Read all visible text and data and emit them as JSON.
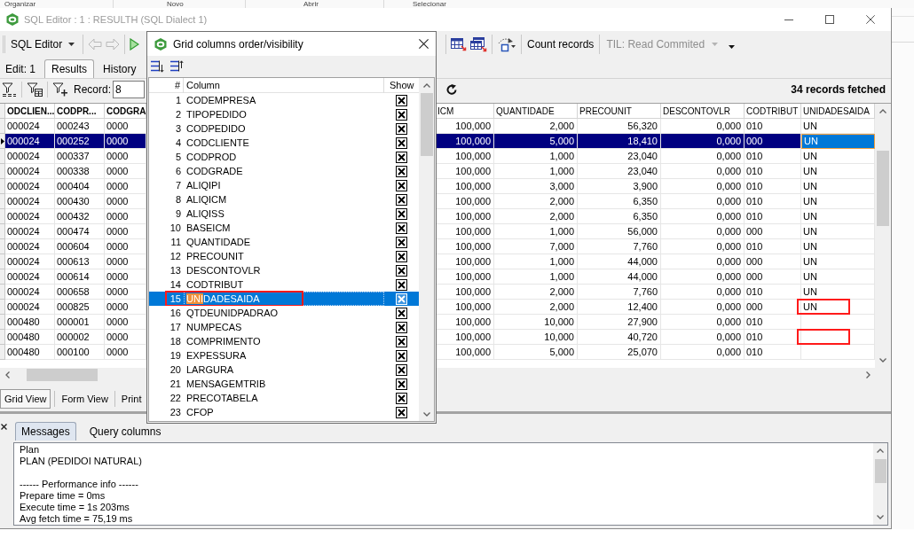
{
  "explorer_ribbon": {
    "buttons": [
      "Organizar",
      "Novo",
      "Abrir",
      "Selecionar"
    ]
  },
  "window": {
    "title": "SQL Editor : 1 : RESULTH (SQL Dialect 1)"
  },
  "toolbar": {
    "editor_menu": "SQL Editor",
    "history_buttons": {
      "disabled": true
    },
    "count_button": "Count records",
    "isolation_level": {
      "label": "TIL: Read Commited",
      "disabled": true
    }
  },
  "tabs": [
    {
      "label": "Edit: 1",
      "selected": false
    },
    {
      "label": "Results",
      "selected": true
    },
    {
      "label": "History",
      "selected": false
    }
  ],
  "record_bar": {
    "label": "Record:",
    "value": "8",
    "status": "34 records fetched"
  },
  "grid": {
    "columns": [
      {
        "label": "ODCLIEN...",
        "key": true,
        "kind": "text"
      },
      {
        "label": "CODPR...",
        "key": true,
        "kind": "text"
      },
      {
        "label": "CODGRA",
        "key": true,
        "kind": "text"
      },
      {
        "label": "ICM",
        "key": false,
        "kind": "number"
      },
      {
        "label": "QUANTIDADE",
        "key": false,
        "kind": "number"
      },
      {
        "label": "PRECOUNIT",
        "key": false,
        "kind": "number"
      },
      {
        "label": "DESCONTOVLR",
        "key": false,
        "kind": "number"
      },
      {
        "label": "CODTRIBUT",
        "key": false,
        "kind": "text"
      },
      {
        "label": "UNIDADESAIDA",
        "key": false,
        "kind": "text"
      }
    ],
    "rows": [
      {
        "cells": [
          "000024",
          "000243",
          "0000",
          "100,000",
          "2,000",
          "56,320",
          "0,000",
          "010",
          "UN"
        ],
        "selected": false,
        "current": false,
        "marked": false
      },
      {
        "cells": [
          "000024",
          "000252",
          "0000",
          "100,000",
          "5,000",
          "18,410",
          "0,000",
          "000",
          "UN"
        ],
        "selected": true,
        "current": true,
        "marked": false
      },
      {
        "cells": [
          "000024",
          "000337",
          "0000",
          "100,000",
          "1,000",
          "23,040",
          "0,000",
          "010",
          "UN"
        ],
        "selected": false,
        "current": false,
        "marked": false
      },
      {
        "cells": [
          "000024",
          "000338",
          "0000",
          "100,000",
          "1,000",
          "23,040",
          "0,000",
          "010",
          "UN"
        ],
        "selected": false,
        "current": false,
        "marked": false
      },
      {
        "cells": [
          "000024",
          "000404",
          "0000",
          "100,000",
          "3,000",
          "3,900",
          "0,000",
          "010",
          "UN"
        ],
        "selected": false,
        "current": false,
        "marked": false
      },
      {
        "cells": [
          "000024",
          "000430",
          "0000",
          "100,000",
          "2,000",
          "6,350",
          "0,000",
          "010",
          "UN"
        ],
        "selected": false,
        "current": false,
        "marked": false
      },
      {
        "cells": [
          "000024",
          "000432",
          "0000",
          "100,000",
          "2,000",
          "6,350",
          "0,000",
          "010",
          "UN"
        ],
        "selected": false,
        "current": false,
        "marked": false
      },
      {
        "cells": [
          "000024",
          "000474",
          "0000",
          "100,000",
          "1,000",
          "56,000",
          "0,000",
          "000",
          "UN"
        ],
        "selected": false,
        "current": false,
        "marked": false
      },
      {
        "cells": [
          "000024",
          "000604",
          "0000",
          "100,000",
          "7,000",
          "7,760",
          "0,000",
          "010",
          "UN"
        ],
        "selected": false,
        "current": false,
        "marked": false
      },
      {
        "cells": [
          "000024",
          "000613",
          "0000",
          "100,000",
          "1,000",
          "44,000",
          "0,000",
          "000",
          "UN"
        ],
        "selected": false,
        "current": false,
        "marked": false
      },
      {
        "cells": [
          "000024",
          "000614",
          "0000",
          "100,000",
          "1,000",
          "44,000",
          "0,000",
          "000",
          "UN"
        ],
        "selected": false,
        "current": false,
        "marked": false
      },
      {
        "cells": [
          "000024",
          "000658",
          "0000",
          "100,000",
          "2,000",
          "7,760",
          "0,000",
          "010",
          "UN"
        ],
        "selected": false,
        "current": false,
        "marked": false
      },
      {
        "cells": [
          "000024",
          "000825",
          "0000",
          "100,000",
          "2,000",
          "12,400",
          "0,000",
          "000",
          "UN"
        ],
        "selected": false,
        "current": false,
        "marked": true
      },
      {
        "cells": [
          "000480",
          "000001",
          "0000",
          "100,000",
          "10,000",
          "27,900",
          "0,000",
          "010"
        ],
        "selected": false,
        "current": false,
        "marked": false
      },
      {
        "cells": [
          "000480",
          "000002",
          "0000",
          "100,000",
          "10,000",
          "40,720",
          "0,000",
          "010"
        ],
        "selected": false,
        "current": false,
        "marked": true
      },
      {
        "cells": [
          "000480",
          "000100",
          "0000",
          "100,000",
          "5,000",
          "25,070",
          "0,000",
          "010"
        ],
        "selected": false,
        "current": false,
        "marked": false
      }
    ]
  },
  "view_tabs": [
    {
      "label": "Grid View",
      "selected": true
    },
    {
      "label": "Form View",
      "selected": false
    },
    {
      "label": "Print",
      "selected": false
    }
  ],
  "messages": {
    "tabs": [
      {
        "label": "Messages",
        "selected": true
      },
      {
        "label": "Query columns",
        "selected": false
      }
    ],
    "blocks": [
      {
        "lines": [
          "Plan",
          "PLAN (PEDIDOI NATURAL)"
        ]
      },
      {
        "lines": [
          "------ Performance info ------",
          "Prepare time = 0ms",
          "Execute time = 1s 203ms",
          "Avg fetch time = 75,19 ms"
        ]
      }
    ]
  },
  "dialog": {
    "title": "Grid columns order/visibility",
    "headers": [
      "#",
      "Column",
      "Show"
    ],
    "items": [
      {
        "number": "1",
        "name": "CODEMPRESA",
        "show": true,
        "selected": false,
        "marked": false
      },
      {
        "number": "2",
        "name": "TIPOPEDIDO",
        "show": true,
        "selected": false,
        "marked": false
      },
      {
        "number": "3",
        "name": "CODPEDIDO",
        "show": true,
        "selected": false,
        "marked": false
      },
      {
        "number": "4",
        "name": "CODCLIENTE",
        "show": true,
        "selected": false,
        "marked": false
      },
      {
        "number": "5",
        "name": "CODPROD",
        "show": true,
        "selected": false,
        "marked": false
      },
      {
        "number": "6",
        "name": "CODGRADE",
        "show": true,
        "selected": false,
        "marked": false
      },
      {
        "number": "7",
        "name": "ALIQIPI",
        "show": true,
        "selected": false,
        "marked": false
      },
      {
        "number": "8",
        "name": "ALIQICM",
        "show": true,
        "selected": false,
        "marked": false
      },
      {
        "number": "9",
        "name": "ALIQISS",
        "show": true,
        "selected": false,
        "marked": false
      },
      {
        "number": "10",
        "name": "BASEICM",
        "show": true,
        "selected": false,
        "marked": false
      },
      {
        "number": "11",
        "name": "QUANTIDADE",
        "show": true,
        "selected": false,
        "marked": false
      },
      {
        "number": "12",
        "name": "PRECOUNIT",
        "show": true,
        "selected": false,
        "marked": false
      },
      {
        "number": "13",
        "name": "DESCONTOVLR",
        "show": true,
        "selected": false,
        "marked": false
      },
      {
        "number": "14",
        "name": "CODTRIBUT",
        "show": true,
        "selected": false,
        "marked": false
      },
      {
        "number": "15",
        "name": "**UNI**DADESAIDA",
        "show": true,
        "selected": true,
        "marked": true
      },
      {
        "number": "16",
        "name": "QTDEUNIDPADRAO",
        "show": true,
        "selected": false,
        "marked": false
      },
      {
        "number": "17",
        "name": "NUMPECAS",
        "show": true,
        "selected": false,
        "marked": false
      },
      {
        "number": "18",
        "name": "COMPRIMENTO",
        "show": true,
        "selected": false,
        "marked": false
      },
      {
        "number": "19",
        "name": "EXPESSURA",
        "show": true,
        "selected": false,
        "marked": false
      },
      {
        "number": "20",
        "name": "LARGURA",
        "show": true,
        "selected": false,
        "marked": false
      },
      {
        "number": "21",
        "name": "MENSAGEMTRIB",
        "show": true,
        "selected": false,
        "marked": false
      },
      {
        "number": "22",
        "name": "PRECOTABELA",
        "show": true,
        "selected": false,
        "marked": false
      },
      {
        "number": "23",
        "name": "CFOP",
        "show": true,
        "selected": false,
        "marked": false
      }
    ]
  }
}
